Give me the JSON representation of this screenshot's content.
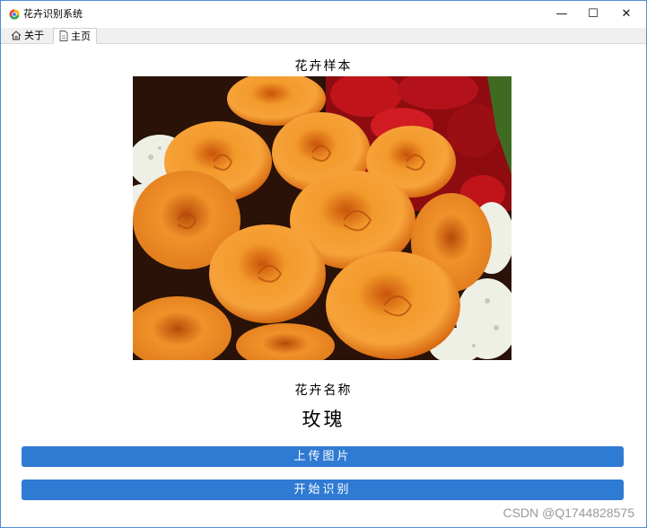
{
  "window": {
    "title": "花卉识别系统",
    "minimize": "—",
    "maximize": "☐",
    "close": "✕"
  },
  "tabs": [
    {
      "label": "关于"
    },
    {
      "label": "主页"
    }
  ],
  "main": {
    "sample_label": "花卉样本",
    "name_label": "花卉名称",
    "result": "玫瑰",
    "upload_button": "上传图片",
    "recognize_button": "开始识别"
  },
  "watermark": "CSDN @Q1744828575",
  "colors": {
    "accent": "#2f7ad3",
    "border": "#4b8fd6"
  },
  "icons": {
    "about_tab": "home-icon",
    "main_tab": "page-icon"
  }
}
